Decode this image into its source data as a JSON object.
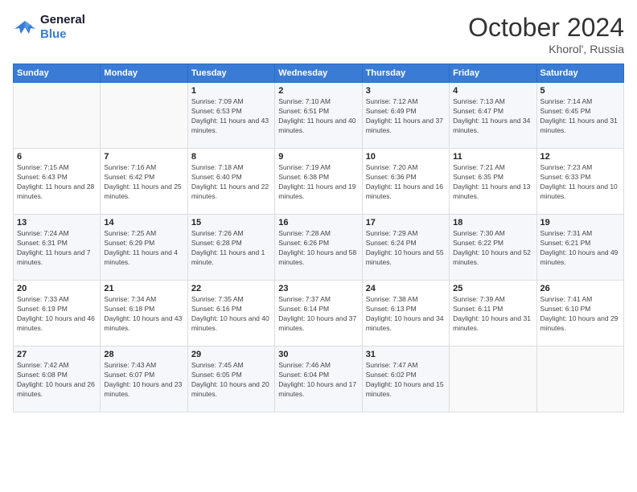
{
  "header": {
    "logo_line1": "General",
    "logo_line2": "Blue",
    "title": "October 2024",
    "subtitle": "Khorol', Russia"
  },
  "weekdays": [
    "Sunday",
    "Monday",
    "Tuesday",
    "Wednesday",
    "Thursday",
    "Friday",
    "Saturday"
  ],
  "weeks": [
    [
      {
        "day": "",
        "info": ""
      },
      {
        "day": "",
        "info": ""
      },
      {
        "day": "1",
        "info": "Sunrise: 7:09 AM\nSunset: 6:53 PM\nDaylight: 11 hours and 43 minutes."
      },
      {
        "day": "2",
        "info": "Sunrise: 7:10 AM\nSunset: 6:51 PM\nDaylight: 11 hours and 40 minutes."
      },
      {
        "day": "3",
        "info": "Sunrise: 7:12 AM\nSunset: 6:49 PM\nDaylight: 11 hours and 37 minutes."
      },
      {
        "day": "4",
        "info": "Sunrise: 7:13 AM\nSunset: 6:47 PM\nDaylight: 11 hours and 34 minutes."
      },
      {
        "day": "5",
        "info": "Sunrise: 7:14 AM\nSunset: 6:45 PM\nDaylight: 11 hours and 31 minutes."
      }
    ],
    [
      {
        "day": "6",
        "info": "Sunrise: 7:15 AM\nSunset: 6:43 PM\nDaylight: 11 hours and 28 minutes."
      },
      {
        "day": "7",
        "info": "Sunrise: 7:16 AM\nSunset: 6:42 PM\nDaylight: 11 hours and 25 minutes."
      },
      {
        "day": "8",
        "info": "Sunrise: 7:18 AM\nSunset: 6:40 PM\nDaylight: 11 hours and 22 minutes."
      },
      {
        "day": "9",
        "info": "Sunrise: 7:19 AM\nSunset: 6:38 PM\nDaylight: 11 hours and 19 minutes."
      },
      {
        "day": "10",
        "info": "Sunrise: 7:20 AM\nSunset: 6:36 PM\nDaylight: 11 hours and 16 minutes."
      },
      {
        "day": "11",
        "info": "Sunrise: 7:21 AM\nSunset: 6:35 PM\nDaylight: 11 hours and 13 minutes."
      },
      {
        "day": "12",
        "info": "Sunrise: 7:23 AM\nSunset: 6:33 PM\nDaylight: 11 hours and 10 minutes."
      }
    ],
    [
      {
        "day": "13",
        "info": "Sunrise: 7:24 AM\nSunset: 6:31 PM\nDaylight: 11 hours and 7 minutes."
      },
      {
        "day": "14",
        "info": "Sunrise: 7:25 AM\nSunset: 6:29 PM\nDaylight: 11 hours and 4 minutes."
      },
      {
        "day": "15",
        "info": "Sunrise: 7:26 AM\nSunset: 6:28 PM\nDaylight: 11 hours and 1 minute."
      },
      {
        "day": "16",
        "info": "Sunrise: 7:28 AM\nSunset: 6:26 PM\nDaylight: 10 hours and 58 minutes."
      },
      {
        "day": "17",
        "info": "Sunrise: 7:29 AM\nSunset: 6:24 PM\nDaylight: 10 hours and 55 minutes."
      },
      {
        "day": "18",
        "info": "Sunrise: 7:30 AM\nSunset: 6:22 PM\nDaylight: 10 hours and 52 minutes."
      },
      {
        "day": "19",
        "info": "Sunrise: 7:31 AM\nSunset: 6:21 PM\nDaylight: 10 hours and 49 minutes."
      }
    ],
    [
      {
        "day": "20",
        "info": "Sunrise: 7:33 AM\nSunset: 6:19 PM\nDaylight: 10 hours and 46 minutes."
      },
      {
        "day": "21",
        "info": "Sunrise: 7:34 AM\nSunset: 6:18 PM\nDaylight: 10 hours and 43 minutes."
      },
      {
        "day": "22",
        "info": "Sunrise: 7:35 AM\nSunset: 6:16 PM\nDaylight: 10 hours and 40 minutes."
      },
      {
        "day": "23",
        "info": "Sunrise: 7:37 AM\nSunset: 6:14 PM\nDaylight: 10 hours and 37 minutes."
      },
      {
        "day": "24",
        "info": "Sunrise: 7:38 AM\nSunset: 6:13 PM\nDaylight: 10 hours and 34 minutes."
      },
      {
        "day": "25",
        "info": "Sunrise: 7:39 AM\nSunset: 6:11 PM\nDaylight: 10 hours and 31 minutes."
      },
      {
        "day": "26",
        "info": "Sunrise: 7:41 AM\nSunset: 6:10 PM\nDaylight: 10 hours and 29 minutes."
      }
    ],
    [
      {
        "day": "27",
        "info": "Sunrise: 7:42 AM\nSunset: 6:08 PM\nDaylight: 10 hours and 26 minutes."
      },
      {
        "day": "28",
        "info": "Sunrise: 7:43 AM\nSunset: 6:07 PM\nDaylight: 10 hours and 23 minutes."
      },
      {
        "day": "29",
        "info": "Sunrise: 7:45 AM\nSunset: 6:05 PM\nDaylight: 10 hours and 20 minutes."
      },
      {
        "day": "30",
        "info": "Sunrise: 7:46 AM\nSunset: 6:04 PM\nDaylight: 10 hours and 17 minutes."
      },
      {
        "day": "31",
        "info": "Sunrise: 7:47 AM\nSunset: 6:02 PM\nDaylight: 10 hours and 15 minutes."
      },
      {
        "day": "",
        "info": ""
      },
      {
        "day": "",
        "info": ""
      }
    ]
  ]
}
